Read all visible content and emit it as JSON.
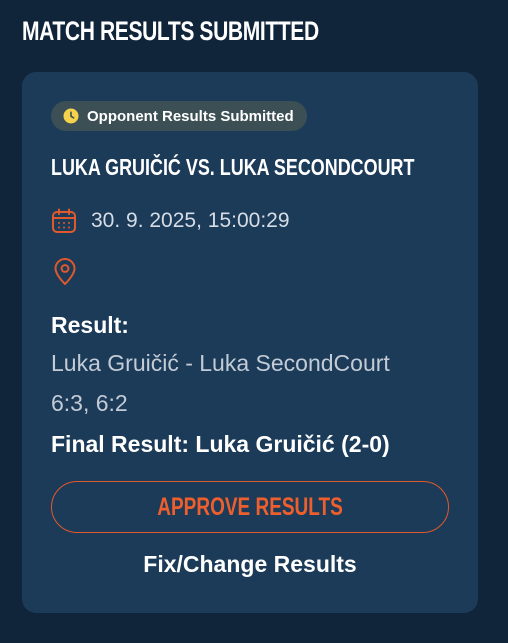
{
  "page": {
    "title": "MATCH RESULTS SUBMITTED"
  },
  "card": {
    "status_badge": {
      "label": "Opponent Results Submitted",
      "icon": "clock-icon",
      "icon_color": "#f5d24b"
    },
    "match_title": "LUKA GRUIČIĆ VS. LUKA SECONDCOURT",
    "datetime": "30. 9. 2025, 15:00:29",
    "datetime_icon": "calendar-icon",
    "location_icon": "map-pin-icon",
    "location": "",
    "result": {
      "label": "Result:",
      "players": "Luka Gruičić - Luka SecondCourt",
      "score": "6:3, 6:2",
      "final": "Final Result: Luka Gruičić (2-0)"
    },
    "actions": {
      "approve_label": "APPROVE RESULTS",
      "fix_label": "Fix/Change Results"
    }
  },
  "colors": {
    "page_background": "#10243a",
    "card_background": "#1c3b58",
    "accent": "#ef5f2d",
    "badge_background": "#3b4f55"
  }
}
